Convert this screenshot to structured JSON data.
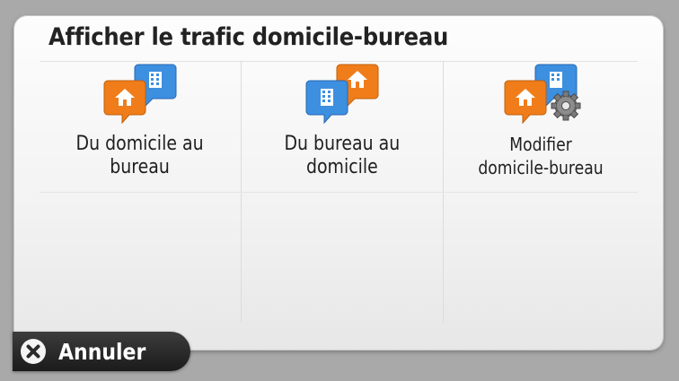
{
  "dialog": {
    "title": "Afficher le trafic domicile-bureau",
    "options": [
      {
        "label": "Du domicile au\nbureau",
        "icon": "home-to-office-icon"
      },
      {
        "label": "Du bureau au\ndomicile",
        "icon": "office-to-home-icon"
      },
      {
        "label": "Modifier\ndomicile-bureau",
        "icon": "edit-home-office-icon"
      }
    ],
    "cancel_label": "Annuler",
    "cancel_icon": "close-icon"
  },
  "colors": {
    "home_pin": "#f07d1a",
    "office_pin": "#3d8fe0",
    "cancel_bar": "#262626"
  }
}
